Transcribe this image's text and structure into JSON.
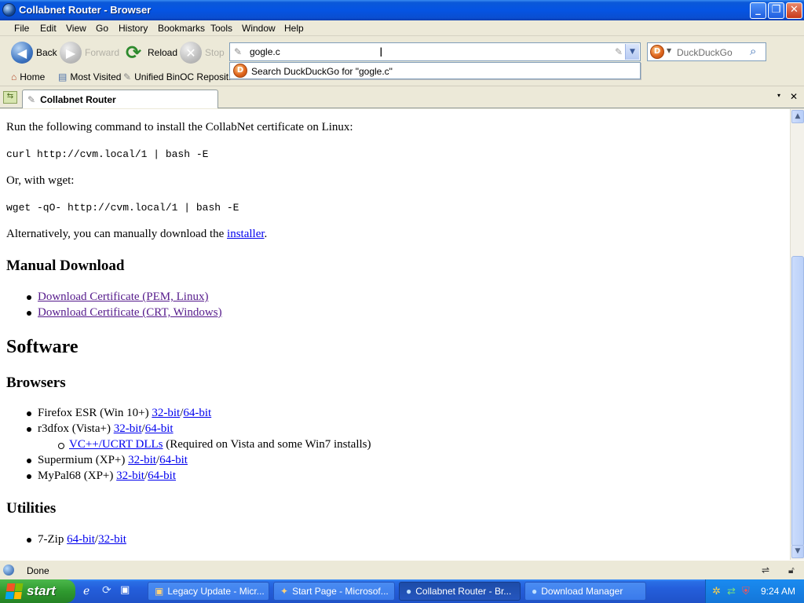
{
  "window": {
    "title": "Collabnet Router - Browser"
  },
  "menu": [
    "File",
    "Edit",
    "View",
    "Go",
    "History",
    "Bookmarks",
    "Tools",
    "Window",
    "Help"
  ],
  "nav": {
    "back": "Back",
    "forward": "Forward",
    "reload": "Reload",
    "stop": "Stop"
  },
  "url": {
    "value": "gogle.c"
  },
  "search": {
    "engine": "DuckDuckGo"
  },
  "autocomplete": {
    "item": "Search DuckDuckGo for \"gogle.c\""
  },
  "bookmarks": [
    "Home",
    "Most Visited",
    "Unified BinOC Reposit..."
  ],
  "tab": {
    "title": "Collabnet Router"
  },
  "content": {
    "p1": "Run the following command to install the CollabNet certificate on Linux:",
    "cmd1": "curl http://cvm.local/1 | bash -E",
    "p2": "Or, with wget:",
    "cmd2": "wget -qO- http://cvm.local/1 | bash -E",
    "p3_pre": "Alternatively, you can manually download the",
    "p3_link": "installer",
    "p3_post": ".",
    "h_manual": "Manual Download",
    "manual_links": [
      "Download Certificate (PEM, Linux)",
      "Download Certificate (CRT, Windows)"
    ],
    "h_software": "Software",
    "h_browsers": "Browsers",
    "browsers": [
      {
        "name": "Firefox ESR (Win 10+)",
        "l1": "32-bit",
        "l2": "64-bit"
      },
      {
        "name": "r3dfox (Vista+)",
        "l1": "32-bit",
        "l2": "64-bit"
      },
      {
        "name": "Supermium (XP+)",
        "l1": "32-bit",
        "l2": "64-bit"
      },
      {
        "name": "MyPal68 (XP+)",
        "l1": "32-bit",
        "l2": "64-bit"
      }
    ],
    "vc_link": "VC++/UCRT DLLs",
    "vc_note": "(Required on Vista and some Win7 installs)",
    "h_utilities": "Utilities",
    "utilities": [
      {
        "name": "7-Zip",
        "l1": "64-bit",
        "l2": "32-bit"
      }
    ],
    "sep": "/"
  },
  "status": {
    "text": "Done"
  },
  "taskbar": {
    "start": "start",
    "tasks": [
      "Legacy Update - Micr...",
      "Start Page - Microsof...",
      "Collabnet Router - Br...",
      "Download Manager"
    ],
    "clock": "9:24 AM"
  },
  "colors": {
    "titlebar": "#0554e3",
    "link": "#0000ee",
    "visited": "#551a8b",
    "taskbar": "#245edb",
    "start": "#2f9a2f"
  }
}
